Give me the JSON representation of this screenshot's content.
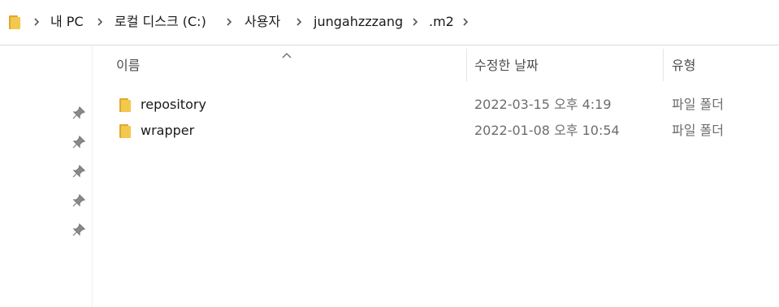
{
  "breadcrumb": {
    "items": [
      "내 PC",
      "로컬 디스크 (C:)",
      "사용자",
      "jungahzzzang",
      ".m2"
    ]
  },
  "columns": {
    "name": "이름",
    "date_modified": "수정한 날짜",
    "type": "유형"
  },
  "files": [
    {
      "name": "repository",
      "date_modified": "2022-03-15 오후 4:19",
      "type": "파일 폴더"
    },
    {
      "name": "wrapper",
      "date_modified": "2022-01-08 오후 10:54",
      "type": "파일 폴더"
    }
  ],
  "colors": {
    "folder": "#F2C94C",
    "folder_dark": "#E0A82E",
    "pin": "#7a7a7a"
  }
}
